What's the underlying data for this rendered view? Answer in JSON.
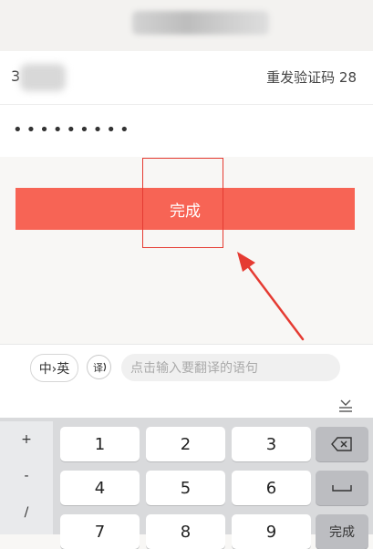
{
  "header": {
    "title_icon": "blurred-title"
  },
  "phone_row": {
    "prefix": "3",
    "resend_label": "重发验证码 28"
  },
  "password_row": {
    "masked_value": "•••••••••"
  },
  "done_button": {
    "label": "完成"
  },
  "annotation": {
    "highlight_color": "#e53b32"
  },
  "translate_bar": {
    "lang_toggle": "中›英",
    "translate_icon": "translate-icon",
    "placeholder": "点击输入要翻译的语句"
  },
  "keyboard": {
    "symbols": [
      "+",
      "-",
      "/"
    ],
    "rows": [
      [
        "1",
        "2",
        "3"
      ],
      [
        "4",
        "5",
        "6"
      ],
      [
        "7",
        "8",
        "9"
      ]
    ],
    "done_label": "完成"
  },
  "colors": {
    "accent": "#f76455",
    "background": "#f8f7f5"
  }
}
